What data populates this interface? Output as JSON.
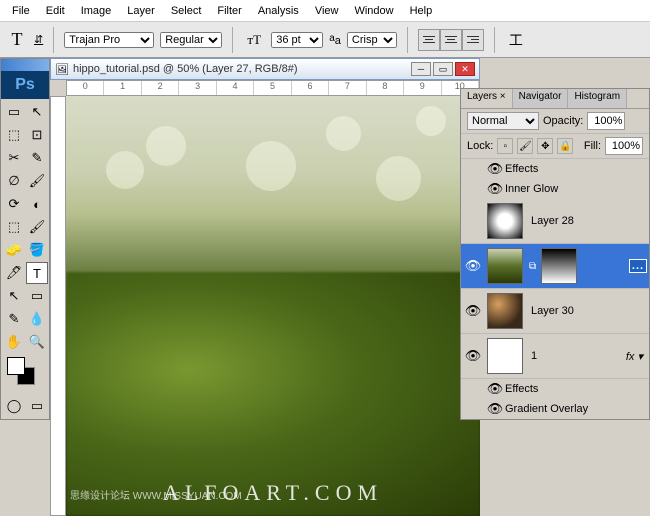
{
  "menu": {
    "items": [
      "File",
      "Edit",
      "Image",
      "Layer",
      "Select",
      "Filter",
      "Analysis",
      "View",
      "Window",
      "Help"
    ]
  },
  "options": {
    "font": "Trajan Pro",
    "weight": "Regular",
    "size": "36 pt",
    "aa": "Crisp"
  },
  "document": {
    "title": "hippo_tutorial.psd @ 50% (Layer 27, RGB/8#)",
    "ruler": [
      "0",
      "1",
      "2",
      "3",
      "4",
      "5",
      "6",
      "7",
      "8",
      "9",
      "10"
    ]
  },
  "watermark": "ALFOART.COM",
  "watermark2": "思缘设计论坛  WWW.MISSYUAN.COM",
  "toolbox": {
    "logo": "Ps",
    "tools": [
      "▭",
      "↖",
      "⬚",
      "⊡",
      "✂",
      "✎",
      "∅",
      "🖌",
      "⟳",
      "◐",
      "⬚",
      "🖌",
      "🧽",
      "🪣",
      "◔",
      "△",
      "🖊",
      "T",
      "↖",
      "▭",
      "✋",
      "🔍"
    ]
  },
  "panel": {
    "tabs": [
      "Layers ×",
      "Navigator",
      "Histogram"
    ],
    "blend": "Normal",
    "opacity_label": "Opacity:",
    "opacity": "100%",
    "lock_label": "Lock:",
    "fill_label": "Fill:",
    "fill": "100%",
    "effects_label": "Effects",
    "inner_glow": "Inner Glow",
    "gradient_overlay": "Gradient Overlay",
    "layers": [
      {
        "name": "Layer 28"
      },
      {
        "name": ""
      },
      {
        "name": "Layer 30"
      },
      {
        "name": "1"
      }
    ]
  }
}
